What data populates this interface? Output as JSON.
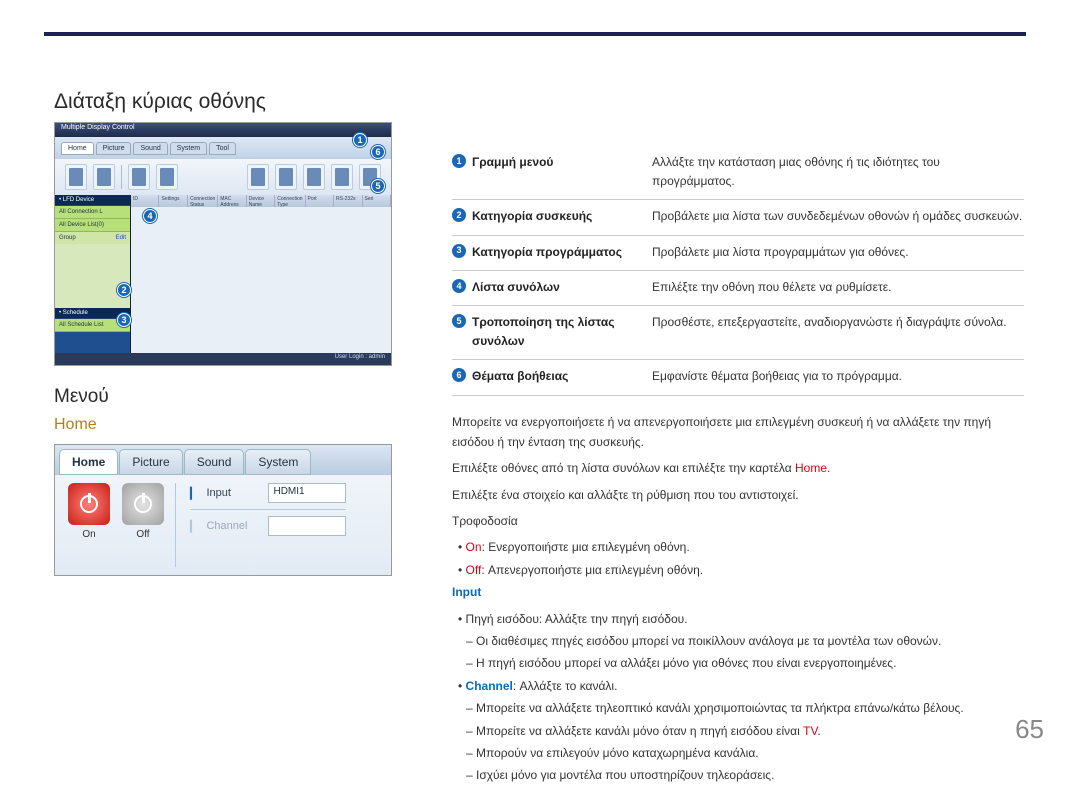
{
  "page_number": "65",
  "headings": {
    "h1": "Διάταξη κύριας οθόνης",
    "h2": "Μενού",
    "subhead": "Home"
  },
  "screenshot1": {
    "title": "Multiple Display Control",
    "tabs": [
      "Home",
      "Picture",
      "Sound",
      "System",
      "Tool"
    ],
    "side": {
      "sec1": "• LFD Device",
      "item1": "All Connection L",
      "item2": "All Device List(0)",
      "grp": "Group",
      "edit": "Edit",
      "sec2": "• Schedule",
      "item3": "All Schedule List"
    },
    "gridcols": [
      "ID",
      "Settings",
      "Connection Status",
      "MAC Address",
      "Device Name",
      "Connection Type",
      "Port",
      "RS-232s",
      "Seri"
    ],
    "status": "User Login : admin",
    "callouts": {
      "1": "1",
      "2": "2",
      "3": "3",
      "4": "4",
      "5": "5",
      "6": "6"
    }
  },
  "screenshot2": {
    "tabs": {
      "home": "Home",
      "picture": "Picture",
      "sound": "Sound",
      "system": "System"
    },
    "on": "On",
    "off": "Off",
    "input_lbl": "Input",
    "input_val": "HDMI1",
    "channel_lbl": "Channel"
  },
  "legend": [
    {
      "n": "1",
      "k": "Γραμμή μενού",
      "v": "Αλλάξτε την κατάσταση μιας οθόνης ή τις ιδιότητες του προγράμματος."
    },
    {
      "n": "2",
      "k": "Κατηγορία συσκευής",
      "v": "Προβάλετε μια λίστα των συνδεδεμένων οθονών ή ομάδες συσκευών."
    },
    {
      "n": "3",
      "k": "Κατηγορία προγράμματος",
      "v": "Προβάλετε μια λίστα προγραμμάτων για οθόνες."
    },
    {
      "n": "4",
      "k": "Λίστα συνόλων",
      "v": "Επιλέξτε την οθόνη που θέλετε να ρυθμίσετε."
    },
    {
      "n": "5",
      "k": "Τροποποίηση της λίστας συνόλων",
      "v": "Προσθέστε, επεξεργαστείτε, αναδιοργανώστε ή διαγράψτε σύνολα."
    },
    {
      "n": "6",
      "k": "Θέματα βοήθειας",
      "v": "Εμφανίστε θέματα βοήθειας για το πρόγραμμα."
    }
  ],
  "body": {
    "p1": "Μπορείτε να ενεργοποιήσετε ή να απενεργοποιήσετε μια επιλεγμένη συσκευή ή να αλλάξετε την πηγή εισόδου ή την ένταση της συσκευής.",
    "p2a": "Επιλέξτε οθόνες από τη λίστα συνόλων και επιλέξτε την καρτέλα ",
    "p2b": "Home",
    "p2c": ".",
    "p3": "Επιλέξτε ένα στοιχείο και αλλάξτε τη ρύθμιση που του αντιστοιχεί.",
    "p4": "Τροφοδοσία",
    "on_lbl": "On",
    "on_txt": ": Ενεργοποιήστε μια επιλεγμένη οθόνη.",
    "off_lbl": "Off",
    "off_txt": ": Απενεργοποιήστε μια επιλεγμένη οθόνη.",
    "input_h": "Input",
    "in1": "Πηγή εισόδου: Αλλάξτε την πηγή εισόδου.",
    "in1a": "Οι διαθέσιμες πηγές εισόδου μπορεί να ποικίλλουν ανάλογα με τα μοντέλα των οθονών.",
    "in1b": "Η πηγή εισόδου μπορεί να αλλάξει μόνο για οθόνες που είναι ενεργοποιημένες.",
    "ch_lbl": "Channel",
    "ch_txt": ": Αλλάξτε το κανάλι.",
    "ch1": "Μπορείτε να αλλάξετε τηλεοπτικό κανάλι χρησιμοποιώντας τα πλήκτρα επάνω/κάτω βέλους.",
    "ch2a": "Μπορείτε να αλλάξετε κανάλι μόνο όταν η πηγή εισόδου είναι ",
    "ch2b": "TV",
    "ch2c": ".",
    "ch3": "Μπορούν να επιλεγούν μόνο καταχωρημένα κανάλια.",
    "ch4": "Ισχύει μόνο για μοντέλα που υποστηρίζουν τηλεοράσεις."
  }
}
